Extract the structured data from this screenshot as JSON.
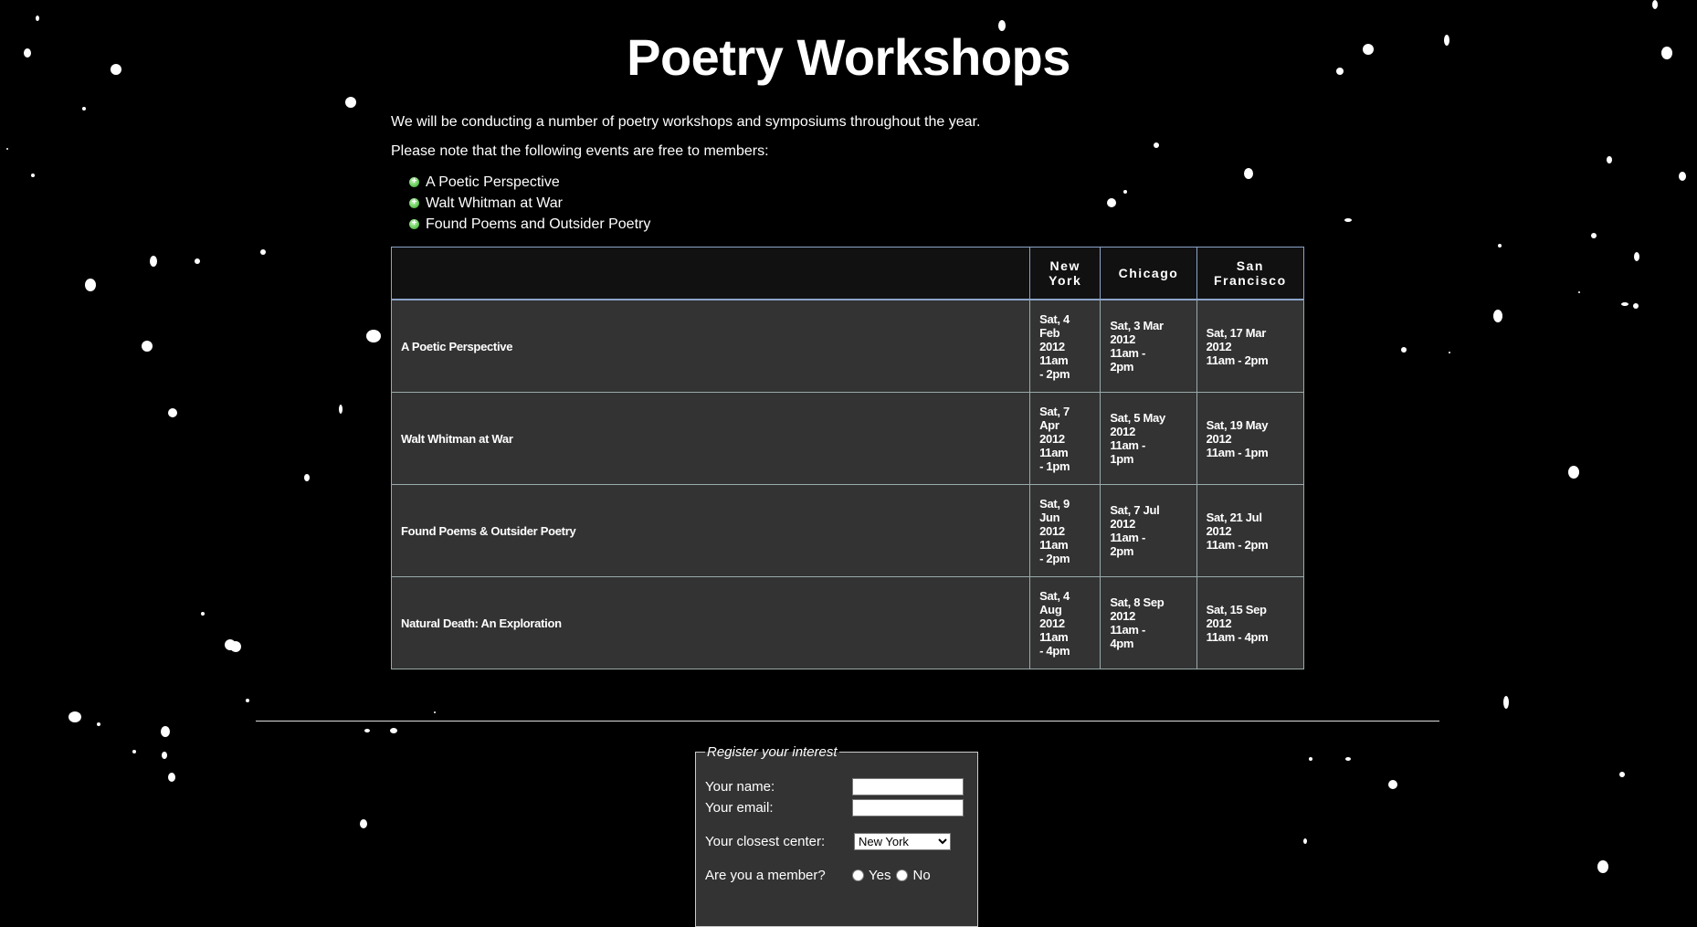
{
  "page": {
    "title": "Poetry Workshops",
    "intro_line_1": "We will be conducting a number of poetry workshops and symposiums throughout the year.",
    "intro_line_2": "Please note that the following events are free to members:",
    "free_events": [
      "A Poetic Perspective",
      "Walt Whitman at War",
      "Found Poems and Outsider Poetry"
    ]
  },
  "schedule": {
    "headers": [
      "",
      "New York",
      "Chicago",
      "San Francisco"
    ],
    "rows": [
      {
        "name": "A Poetic Perspective",
        "ny": [
          "Sat, 4",
          "Feb",
          "2012",
          "11am",
          "- 2pm"
        ],
        "chi": [
          "Sat, 3 Mar",
          "2012",
          "11am -",
          "2pm"
        ],
        "sf": [
          "Sat, 17 Mar",
          "2012",
          "11am - 2pm"
        ]
      },
      {
        "name": "Walt Whitman at War",
        "ny": [
          "Sat, 7",
          "Apr",
          "2012",
          "11am",
          "- 1pm"
        ],
        "chi": [
          "Sat, 5 May",
          "2012",
          "11am -",
          "1pm"
        ],
        "sf": [
          "Sat, 19 May",
          "2012",
          "11am - 1pm"
        ]
      },
      {
        "name": "Found Poems & Outsider Poetry",
        "ny": [
          "Sat, 9",
          "Jun",
          "2012",
          "11am",
          "- 2pm"
        ],
        "chi": [
          "Sat, 7 Jul",
          "2012",
          "11am -",
          "2pm"
        ],
        "sf": [
          "Sat, 21 Jul",
          "2012",
          "11am - 2pm"
        ]
      },
      {
        "name": "Natural Death: An Exploration",
        "ny": [
          "Sat, 4",
          "Aug",
          "2012",
          "11am",
          "- 4pm"
        ],
        "chi": [
          "Sat, 8 Sep",
          "2012",
          "11am -",
          "4pm"
        ],
        "sf": [
          "Sat, 15 Sep",
          "2012",
          "11am - 4pm"
        ]
      }
    ]
  },
  "register": {
    "legend": "Register your interest",
    "name_label": "Your name:",
    "name_value": "",
    "email_label": "Your email:",
    "email_value": "",
    "center_label": "Your closest center:",
    "center_selected": "New York",
    "member_label": "Are you a member?",
    "member_yes": "Yes",
    "member_no": "No"
  },
  "colors": {
    "background": "#000000",
    "table_cell": "#333333",
    "table_header": "#111111",
    "header_border": "#8aa4c8",
    "bullet": "#6ccf5e"
  }
}
